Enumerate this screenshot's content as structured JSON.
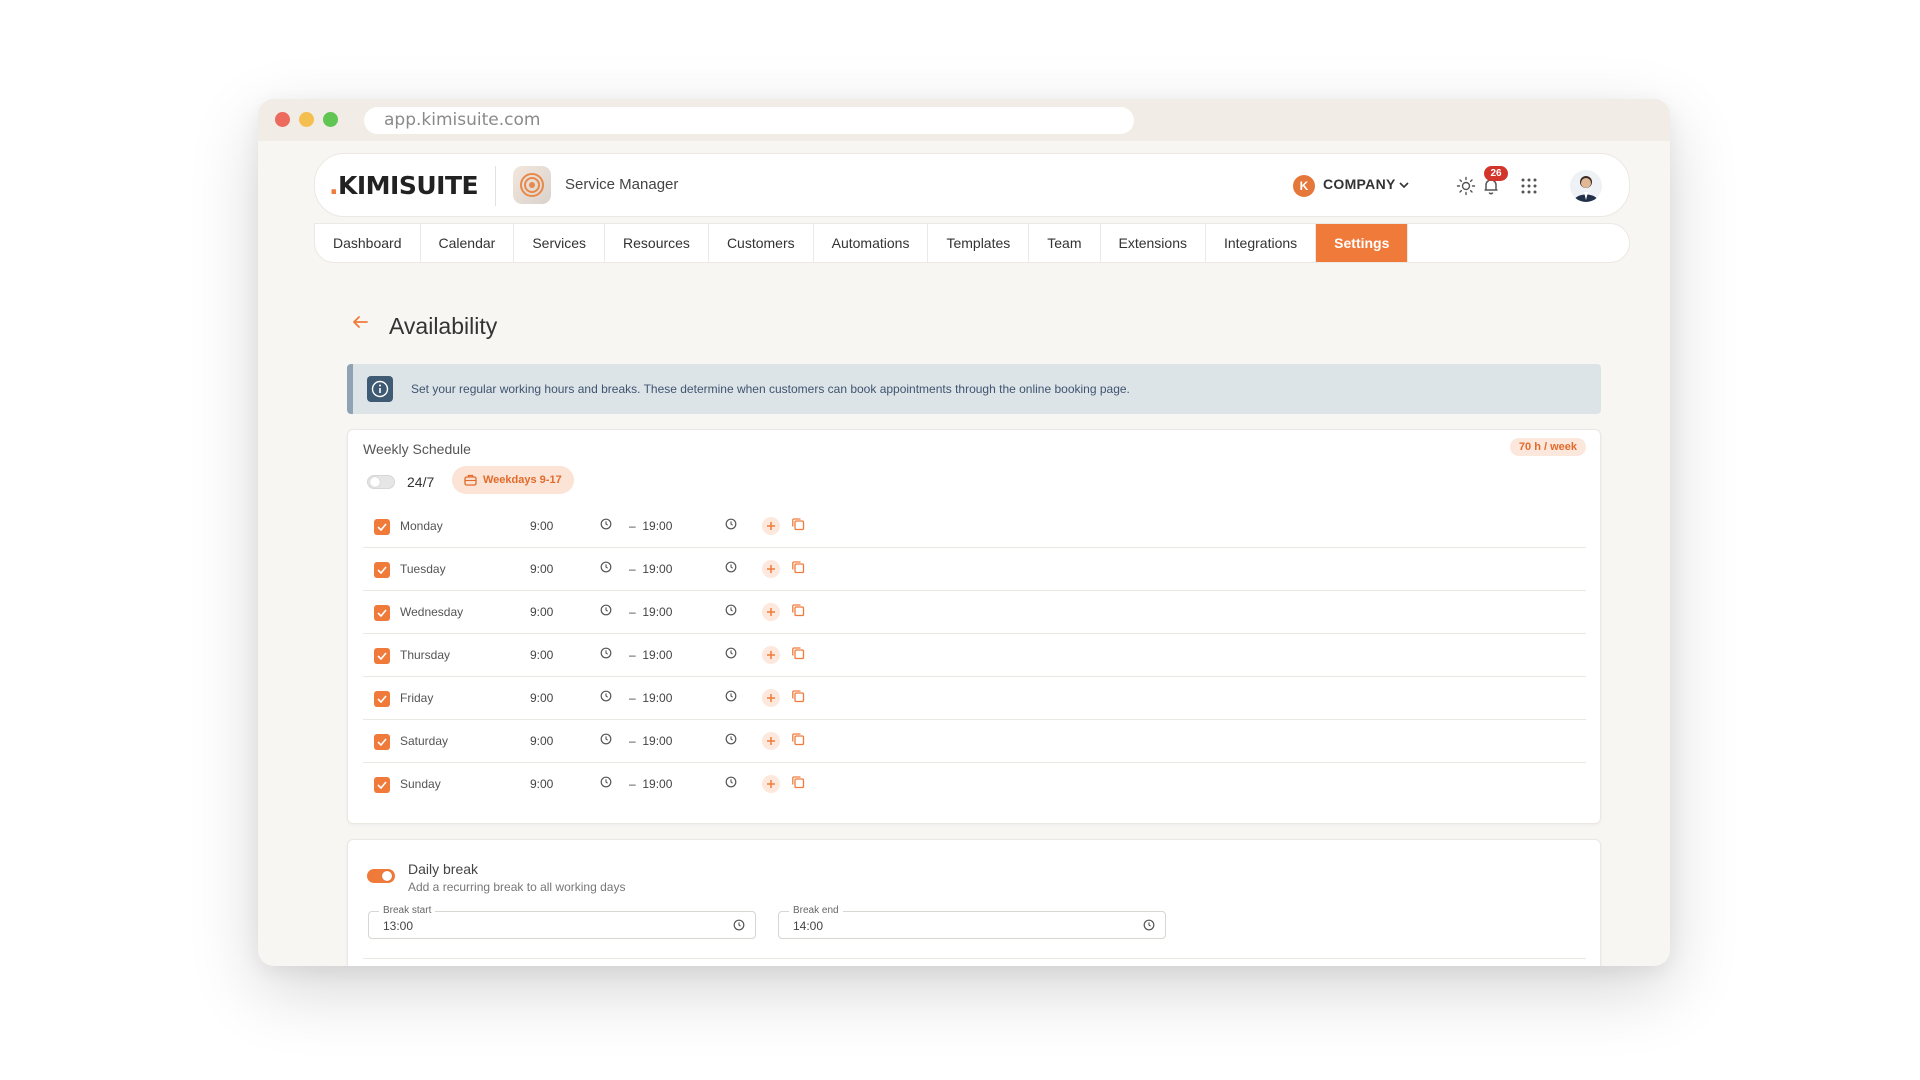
{
  "browser": {
    "url": "app.kimisuite.com"
  },
  "header": {
    "logo_dot": ".",
    "logo_text": "KIMISUITE",
    "app_name": "Service Manager",
    "company_initial": "K",
    "company_name": "COMPANY",
    "notification_count": "26"
  },
  "nav": {
    "tabs": [
      {
        "label": "Dashboard"
      },
      {
        "label": "Calendar"
      },
      {
        "label": "Services"
      },
      {
        "label": "Resources"
      },
      {
        "label": "Customers"
      },
      {
        "label": "Automations"
      },
      {
        "label": "Templates"
      },
      {
        "label": "Team"
      },
      {
        "label": "Extensions"
      },
      {
        "label": "Integrations"
      },
      {
        "label": "Settings",
        "active": true
      }
    ]
  },
  "page": {
    "title": "Availability",
    "info_text": "Set your regular working hours and breaks. These determine when customers can book appointments through the online booking page."
  },
  "weekly": {
    "title": "Weekly Schedule",
    "hours_badge": "70 h / week",
    "always_on_label": "24/7",
    "always_on_enabled": false,
    "preset_label": "Weekdays 9-17",
    "days": [
      {
        "name": "Monday",
        "checked": true,
        "start": "9:00",
        "separator": "–",
        "end": "19:00"
      },
      {
        "name": "Tuesday",
        "checked": true,
        "start": "9:00",
        "separator": "–",
        "end": "19:00"
      },
      {
        "name": "Wednesday",
        "checked": true,
        "start": "9:00",
        "separator": "–",
        "end": "19:00"
      },
      {
        "name": "Thursday",
        "checked": true,
        "start": "9:00",
        "separator": "–",
        "end": "19:00"
      },
      {
        "name": "Friday",
        "checked": true,
        "start": "9:00",
        "separator": "–",
        "end": "19:00"
      },
      {
        "name": "Saturday",
        "checked": true,
        "start": "9:00",
        "separator": "–",
        "end": "19:00"
      },
      {
        "name": "Sunday",
        "checked": true,
        "start": "9:00",
        "separator": "–",
        "end": "19:00"
      }
    ]
  },
  "daily_break": {
    "enabled": true,
    "title": "Daily break",
    "subtitle": "Add a recurring break to all working days",
    "start_label": "Break start",
    "start_value": "13:00",
    "end_label": "Break end",
    "end_value": "14:00"
  },
  "colors": {
    "accent": "#f07a3a",
    "info_bg": "#dde4e8",
    "info_icon": "#3f5a73",
    "badge_red": "#d2352b"
  },
  "icons": {
    "back": "arrow-left-icon",
    "info": "info-icon",
    "clock": "clock-icon",
    "add": "plus-icon",
    "copy": "copy-icon",
    "theme": "sun-icon",
    "notifications": "bell-icon",
    "apps": "grid-icon",
    "preset": "briefcase-icon"
  }
}
